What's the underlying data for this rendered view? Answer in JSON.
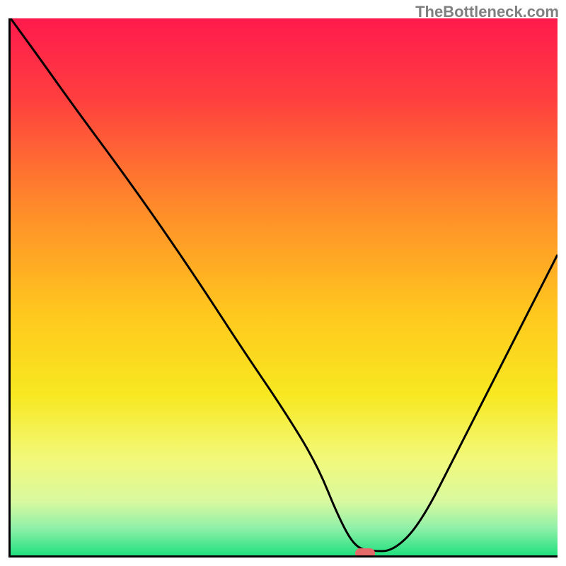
{
  "watermark": "TheBottleneck.com",
  "chart_data": {
    "type": "line",
    "title": "",
    "xlabel": "",
    "ylabel": "",
    "xlim": [
      0,
      100
    ],
    "ylim": [
      0,
      100
    ],
    "grid": false,
    "background_gradient": {
      "orientation": "vertical",
      "stops": [
        {
          "offset": 0.0,
          "color": "#ff1a4d"
        },
        {
          "offset": 0.15,
          "color": "#ff3f3f"
        },
        {
          "offset": 0.35,
          "color": "#ff8a2a"
        },
        {
          "offset": 0.55,
          "color": "#ffc81e"
        },
        {
          "offset": 0.7,
          "color": "#f7e820"
        },
        {
          "offset": 0.82,
          "color": "#f2f97a"
        },
        {
          "offset": 0.9,
          "color": "#d9f9a0"
        },
        {
          "offset": 0.95,
          "color": "#8ef0a8"
        },
        {
          "offset": 1.0,
          "color": "#20e07e"
        }
      ]
    },
    "series": [
      {
        "name": "bottleneck-curve",
        "color": "#000000",
        "x": [
          0,
          5,
          12,
          20,
          27,
          35,
          42,
          50,
          56,
          60,
          63,
          66,
          70,
          75,
          82,
          90,
          100
        ],
        "values": [
          100,
          93,
          83,
          72,
          62,
          50,
          39,
          27,
          17,
          7,
          1.5,
          0.8,
          0.8,
          6,
          20,
          36,
          56
        ]
      }
    ],
    "marker": {
      "name": "optimal-point",
      "x": 64.5,
      "y": 0.8,
      "color": "#e46a6a"
    }
  }
}
